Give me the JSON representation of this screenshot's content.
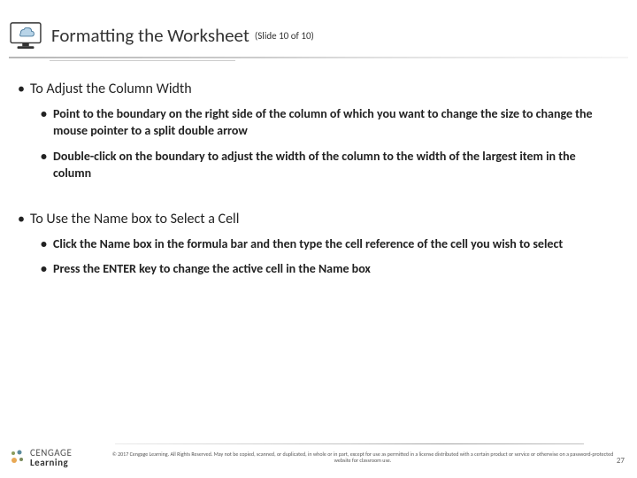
{
  "header": {
    "title": "Formatting the Worksheet",
    "slide_counter": "(Slide 10 of 10)"
  },
  "sections": [
    {
      "heading": "To Adjust the Column Width",
      "bullets": [
        "Point to the boundary on the right side of the column of which you want to change the size to change the mouse pointer to a split double arrow",
        "Double-click on the boundary to adjust the width of the column to the width of the largest item in the column"
      ]
    },
    {
      "heading": "To Use the Name box to Select a Cell",
      "bullets": [
        "Click the Name box in the formula bar and then type the cell reference of the cell you wish to select",
        "Press the ENTER key to change the active cell in the Name box"
      ]
    }
  ],
  "footer": {
    "logo_top": "CENGAGE",
    "logo_bottom": "Learning",
    "copyright": "© 2017 Cengage Learning. All Rights Reserved. May not be copied, scanned, or duplicated, in whole or in part, except for use as permitted in a license distributed with a certain product or service or otherwise on a password-protected website for classroom use.",
    "page_number": "27"
  }
}
